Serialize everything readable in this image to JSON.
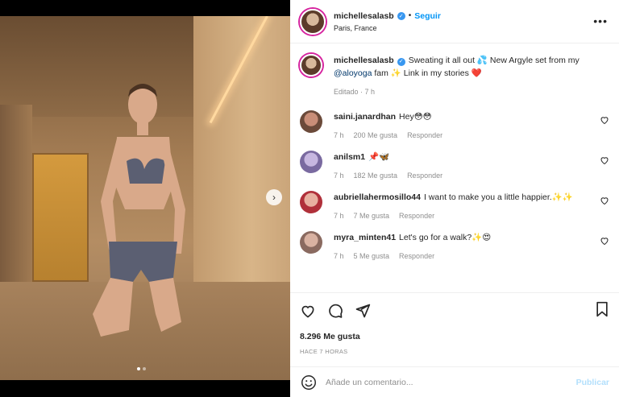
{
  "post": {
    "username": "michellesalasb",
    "follow_label": "Seguir",
    "location": "Paris, France",
    "more_label": "•••"
  },
  "caption": {
    "username": "michellesalasb",
    "text_1": "Sweating it all out 💦 New Argyle set from my",
    "mention": "@aloyoga",
    "text_2": "fam ✨ Link in my stories ❤️",
    "edited": "Editado · 7 h"
  },
  "comments": [
    {
      "username": "saini.janardhan",
      "text": "Hey😳😳",
      "time": "7 h",
      "likes": "200 Me gusta",
      "reply": "Responder",
      "avatar_color": "#6b4a3a"
    },
    {
      "username": "anilsm1",
      "text": "📌🦋",
      "time": "7 h",
      "likes": "182 Me gusta",
      "reply": "Responder",
      "avatar_color": "#7a6aa0"
    },
    {
      "username": "aubriellahermosillo44",
      "text": "I want to make you a little happier.✨✨",
      "time": "7 h",
      "likes": "7 Me gusta",
      "reply": "Responder",
      "avatar_color": "#b0303a"
    },
    {
      "username": "myra_minten41",
      "text": "Let's go for a walk?✨😍",
      "time": "7 h",
      "likes": "5 Me gusta",
      "reply": "Responder",
      "avatar_color": "#8a6a60"
    }
  ],
  "stats": {
    "likes": "8.296 Me gusta",
    "time": "HACE 7 HORAS"
  },
  "composer": {
    "placeholder": "Añade un comentario...",
    "publish_label": "Publicar"
  },
  "colors": {
    "accent": "#0095f6",
    "publish_disabled": "#b2dffc"
  },
  "carousel": {
    "current": 1,
    "total": 2
  }
}
